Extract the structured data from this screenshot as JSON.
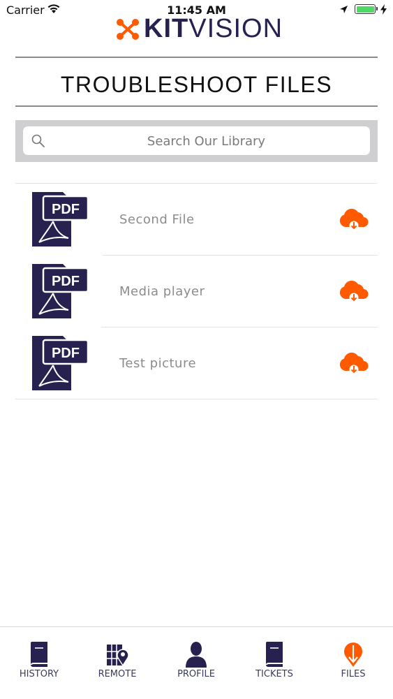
{
  "status_bar": {
    "carrier": "Carrier",
    "time": "11:45 AM"
  },
  "brand": {
    "logo_bold": "KIT",
    "logo_light": "VISION",
    "navy": "#27214f",
    "orange": "#ff5a00"
  },
  "page": {
    "title": "TROUBLESHOOT FILES"
  },
  "search": {
    "placeholder": "Search Our Library",
    "value": ""
  },
  "files": [
    {
      "name": "Second File",
      "badge": "PDF",
      "icon": "pdf-file-icon",
      "action_icon": "cloud-download-icon"
    },
    {
      "name": "Media player",
      "badge": "PDF",
      "icon": "pdf-file-icon",
      "action_icon": "cloud-download-icon"
    },
    {
      "name": "Test picture",
      "badge": "PDF",
      "icon": "pdf-file-icon",
      "action_icon": "cloud-download-icon"
    }
  ],
  "tabbar": {
    "active": "FILES",
    "items": [
      {
        "label": "HISTORY",
        "icon": "book-icon"
      },
      {
        "label": "REMOTE",
        "icon": "map-pin-icon"
      },
      {
        "label": "PROFILE",
        "icon": "person-icon"
      },
      {
        "label": "TICKETS",
        "icon": "book-icon"
      },
      {
        "label": "FILES",
        "icon": "download-pin-icon"
      }
    ]
  }
}
